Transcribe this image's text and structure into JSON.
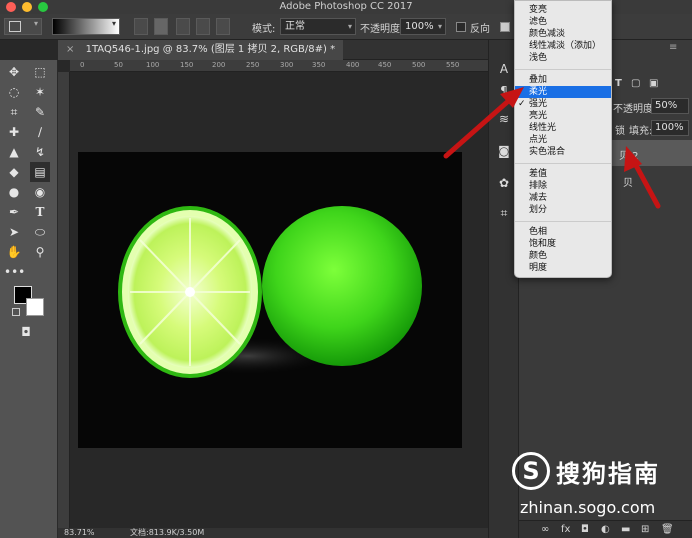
{
  "app": {
    "title": "Adobe Photoshop CC 2017"
  },
  "colors": {
    "close": "#fe5f57",
    "minimize": "#febc2e",
    "zoom": "#28c840",
    "menu_highlight": "#1a6fe5",
    "arrow": "#c61414"
  },
  "options_bar": {
    "mode_label": "模式:",
    "mode_value": "正常",
    "opacity_label": "不透明度:",
    "opacity_value": "100%",
    "reverse_label": "反向"
  },
  "document_tab": {
    "title": "1TAQ546-1.jpg @ 83.7% (图层 1 拷贝 2, RGB/8#) *"
  },
  "ruler": {
    "ticks": [
      "0",
      "50",
      "100",
      "150",
      "200",
      "250",
      "300",
      "350",
      "400",
      "450",
      "500",
      "550"
    ]
  },
  "status_bar": {
    "zoom": "83.71%",
    "doc_info": "文档:813.9K/3.50M"
  },
  "blend_menu": {
    "groups": [
      [
        "变亮",
        "滤色",
        "颜色减淡",
        "线性减淡（添加）",
        "浅色"
      ],
      [
        "叠加",
        "柔光",
        "强光",
        "亮光",
        "线性光",
        "点光",
        "实色混合"
      ],
      [
        "差值",
        "排除",
        "减去",
        "划分"
      ],
      [
        "色相",
        "饱和度",
        "颜色",
        "明度"
      ]
    ],
    "selected": "柔光"
  },
  "layers_panel": {
    "opacity_label": "不透明度:",
    "opacity_value": "50%",
    "lock_label": "锁",
    "fill_label": "填充:",
    "fill_value": "100%",
    "layer_name": "贝 2",
    "layer_name2": "贝"
  },
  "watermark": {
    "name": "搜狗指南",
    "url": "zhinan.sogo.com"
  }
}
